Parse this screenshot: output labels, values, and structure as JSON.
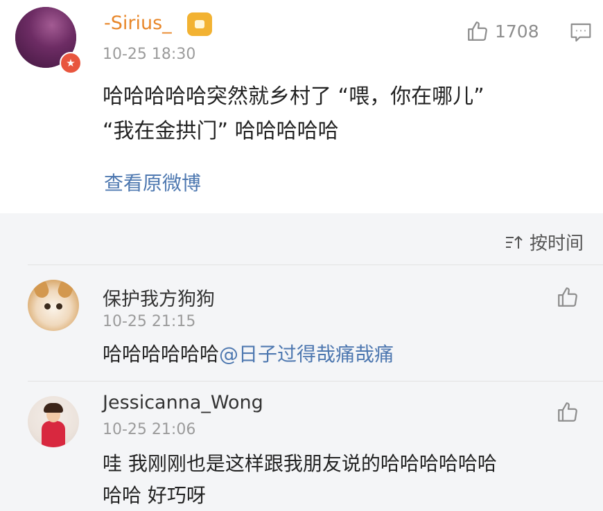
{
  "post": {
    "username": "-Sirius_",
    "time": "10-25 18:30",
    "like_count": "1708",
    "content_line1": "哈哈哈哈哈突然就乡村了 “喂，你在哪儿”",
    "content_line2": "“我在金拱门” 哈哈哈哈哈",
    "view_original": "查看原微博"
  },
  "sort": {
    "label": "按时间"
  },
  "comments": [
    {
      "username": "保护我方狗狗",
      "time": "10-25 21:15",
      "text": "哈哈哈哈哈哈",
      "mention": "@日子过得哉痛哉痛"
    },
    {
      "username": "Jessicanna_Wong",
      "time": "10-25 21:06",
      "text_line1": "哇 我刚刚也是这样跟我朋友说的哈哈哈哈哈哈",
      "text_line2": "哈哈 好巧呀"
    }
  ],
  "icons": {
    "vip": "star-badge-icon",
    "crown": "crown-icon",
    "like": "thumbs-up-icon",
    "comment": "comment-icon",
    "sort": "sort-icon"
  },
  "colors": {
    "username_vip": "#e8872a",
    "link": "#4e78b0",
    "vip_badge": "#e8553e"
  }
}
